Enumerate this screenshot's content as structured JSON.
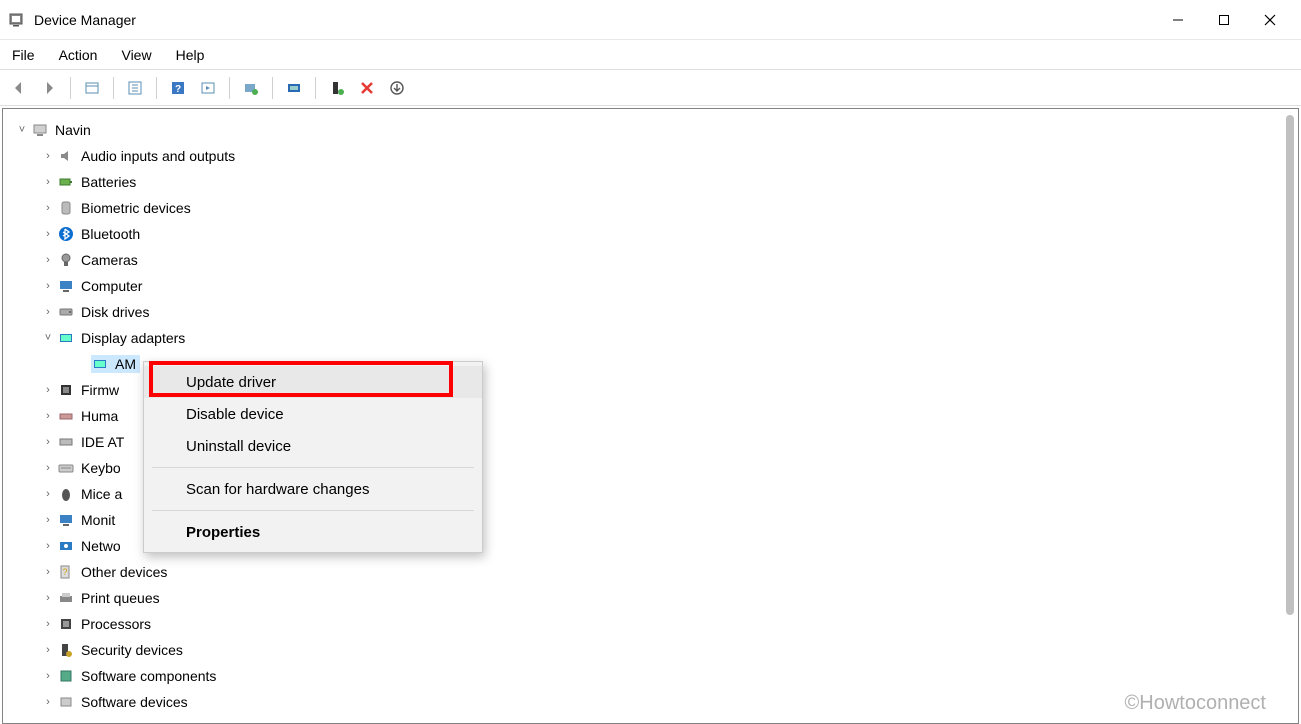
{
  "window": {
    "title": "Device Manager"
  },
  "menubar": {
    "file": "File",
    "action": "Action",
    "view": "View",
    "help": "Help"
  },
  "tree": {
    "root": "Navin",
    "nodes": [
      {
        "label": "Audio inputs and outputs"
      },
      {
        "label": "Batteries"
      },
      {
        "label": "Biometric devices"
      },
      {
        "label": "Bluetooth"
      },
      {
        "label": "Cameras"
      },
      {
        "label": "Computer"
      },
      {
        "label": "Disk drives"
      },
      {
        "label": "Display adapters"
      },
      {
        "label": "Firmw"
      },
      {
        "label": "Huma"
      },
      {
        "label": "IDE AT"
      },
      {
        "label": "Keybo"
      },
      {
        "label": "Mice a"
      },
      {
        "label": "Monit"
      },
      {
        "label": "Netwo"
      },
      {
        "label": "Other devices"
      },
      {
        "label": "Print queues"
      },
      {
        "label": "Processors"
      },
      {
        "label": "Security devices"
      },
      {
        "label": "Software components"
      },
      {
        "label": "Software devices"
      }
    ],
    "selected_device": "AM"
  },
  "context_menu": {
    "update_driver": "Update driver",
    "disable_device": "Disable device",
    "uninstall_device": "Uninstall device",
    "scan_hardware": "Scan for hardware changes",
    "properties": "Properties"
  },
  "watermark": "©Howtoconnect"
}
